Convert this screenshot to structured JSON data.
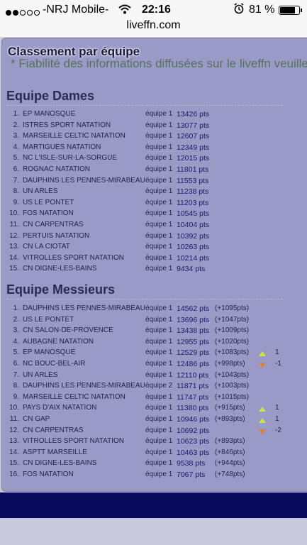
{
  "status_bar": {
    "carrier": "-NRJ Mobile-",
    "time": "22:16",
    "battery": "81 %",
    "battery_level": 0.81,
    "signal_dots": [
      true,
      true,
      false,
      false,
      false
    ],
    "icons": [
      "wifi-icon",
      "alarm-icon",
      "battery-icon"
    ]
  },
  "url": "liveffn.com",
  "page": {
    "title": "Classement par équipe",
    "notice": "* Fiabilité des informations diffusées sur le liveffn veuillez consulter la légende.",
    "colors": {
      "panel": "#9a9ac6",
      "footer": "#0a0a5a",
      "up_arrow": "#c8e836",
      "down_arrow": "#e08030"
    }
  },
  "dames": {
    "title": "Equipe Dames",
    "rows": [
      {
        "rank": "1.",
        "team": "EP MANOSQUE",
        "eq": "équipe 1",
        "pts": "13426 pts"
      },
      {
        "rank": "2.",
        "team": "ISTRES SPORT NATATION",
        "eq": "équipe 1",
        "pts": "13077 pts"
      },
      {
        "rank": "3.",
        "team": "MARSEILLE CELTIC NATATION",
        "eq": "équipe 1",
        "pts": "12607 pts"
      },
      {
        "rank": "4.",
        "team": "MARTIGUES NATATION",
        "eq": "équipe 1",
        "pts": "12349 pts"
      },
      {
        "rank": "5.",
        "team": "NC L'ISLE-SUR-LA-SORGUE",
        "eq": "équipe 1",
        "pts": "12015 pts"
      },
      {
        "rank": "6.",
        "team": "ROGNAC NATATION",
        "eq": "équipe 1",
        "pts": "11801 pts"
      },
      {
        "rank": "7.",
        "team": "DAUPHINS LES PENNES-MIRABEAU",
        "eq": "équipe 1",
        "pts": "11553 pts"
      },
      {
        "rank": "8.",
        "team": "UN ARLES",
        "eq": "équipe 1",
        "pts": "11238 pts"
      },
      {
        "rank": "9.",
        "team": "US LE PONTET",
        "eq": "équipe 1",
        "pts": "11203 pts"
      },
      {
        "rank": "10.",
        "team": "FOS NATATION",
        "eq": "équipe 1",
        "pts": "10545 pts"
      },
      {
        "rank": "11.",
        "team": "CN CARPENTRAS",
        "eq": "équipe 1",
        "pts": "10404 pts"
      },
      {
        "rank": "12.",
        "team": "PERTUIS NATATION",
        "eq": "équipe 1",
        "pts": "10392 pts"
      },
      {
        "rank": "13.",
        "team": "CN LA CIOTAT",
        "eq": "équipe 1",
        "pts": "10263 pts"
      },
      {
        "rank": "14.",
        "team": "VITROLLES SPORT NATATION",
        "eq": "équipe 1",
        "pts": "10214 pts"
      },
      {
        "rank": "15.",
        "team": "CN DIGNE-LES-BAINS",
        "eq": "équipe 1",
        "pts": "9434 pts"
      }
    ]
  },
  "messieurs": {
    "title": "Equipe Messieurs",
    "rows": [
      {
        "rank": "1.",
        "team": "DAUPHINS LES PENNES-MIRABEAU",
        "eq": "équipe 1",
        "pts": "14562 pts",
        "gap": "(+1095pts)",
        "dir": "",
        "move": ""
      },
      {
        "rank": "2.",
        "team": "US LE PONTET",
        "eq": "équipe 1",
        "pts": "13696 pts",
        "gap": "(+1047pts)",
        "dir": "",
        "move": ""
      },
      {
        "rank": "3.",
        "team": "CN SALON-DE-PROVENCE",
        "eq": "équipe 1",
        "pts": "13438 pts",
        "gap": "(+1009pts)",
        "dir": "",
        "move": ""
      },
      {
        "rank": "4.",
        "team": "AUBAGNE NATATION",
        "eq": "équipe 1",
        "pts": "12955 pts",
        "gap": "(+1020pts)",
        "dir": "",
        "move": ""
      },
      {
        "rank": "5.",
        "team": "EP MANOSQUE",
        "eq": "équipe 1",
        "pts": "12529 pts",
        "gap": "(+1083pts)",
        "dir": "up",
        "move": "1"
      },
      {
        "rank": "6.",
        "team": "NC BOUC-BEL-AIR",
        "eq": "équipe 1",
        "pts": "12486 pts",
        "gap": "(+998pts)",
        "dir": "down",
        "move": "-1"
      },
      {
        "rank": "7.",
        "team": "UN ARLES",
        "eq": "équipe 1",
        "pts": "12110 pts",
        "gap": "(+1043pts)",
        "dir": "",
        "move": ""
      },
      {
        "rank": "8.",
        "team": "DAUPHINS LES PENNES-MIRABEAU",
        "eq": "équipe 2",
        "pts": "11871 pts",
        "gap": "(+1003pts)",
        "dir": "",
        "move": ""
      },
      {
        "rank": "9.",
        "team": "MARSEILLE CELTIC NATATION",
        "eq": "équipe 1",
        "pts": "11747 pts",
        "gap": "(+1015pts)",
        "dir": "",
        "move": ""
      },
      {
        "rank": "10.",
        "team": "PAYS D'AIX NATATION",
        "eq": "équipe 1",
        "pts": "11380 pts",
        "gap": "(+915pts)",
        "dir": "up",
        "move": "1"
      },
      {
        "rank": "11.",
        "team": "CN GAP",
        "eq": "équipe 1",
        "pts": "10946 pts",
        "gap": "(+893pts)",
        "dir": "up",
        "move": "1"
      },
      {
        "rank": "12.",
        "team": "CN CARPENTRAS",
        "eq": "équipe 1",
        "pts": "10692 pts",
        "gap": "",
        "dir": "down",
        "move": "-2"
      },
      {
        "rank": "13.",
        "team": "VITROLLES SPORT NATATION",
        "eq": "équipe 1",
        "pts": "10623 pts",
        "gap": "(+893pts)",
        "dir": "",
        "move": ""
      },
      {
        "rank": "14.",
        "team": "ASPTT MARSEILLE",
        "eq": "équipe 1",
        "pts": "10463 pts",
        "gap": "(+846pts)",
        "dir": "",
        "move": ""
      },
      {
        "rank": "15.",
        "team": "CN DIGNE-LES-BAINS",
        "eq": "équipe 1",
        "pts": "9538 pts",
        "gap": "(+944pts)",
        "dir": "",
        "move": ""
      },
      {
        "rank": "16.",
        "team": "FOS NATATION",
        "eq": "équipe 1",
        "pts": "7067 pts",
        "gap": "(+748pts)",
        "dir": "",
        "move": ""
      }
    ]
  }
}
